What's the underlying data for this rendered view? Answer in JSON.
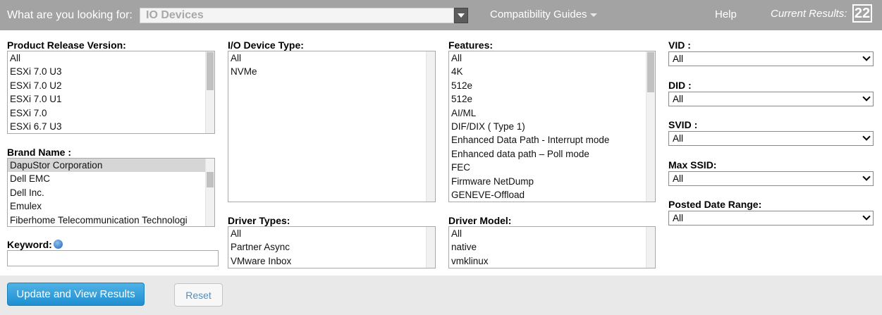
{
  "header": {
    "search_label": "What are you looking for:",
    "search_value": "IO Devices",
    "guides_label": "Compatibility Guides",
    "help_label": "Help",
    "results_label": "Current Results:",
    "results_count": "22"
  },
  "filters": {
    "product_release": {
      "label": "Product Release Version:",
      "options": [
        "All",
        "ESXi 7.0 U3",
        "ESXi 7.0 U2",
        "ESXi 7.0 U1",
        "ESXi 7.0",
        "ESXi 6.7 U3"
      ]
    },
    "brand": {
      "label": "Brand Name :",
      "options": [
        "DapuStor Corporation",
        "Dell EMC",
        "Dell Inc.",
        "Emulex",
        "Fiberhome Telecommunication Technologi"
      ]
    },
    "keyword": {
      "label": "Keyword:"
    },
    "io_device_type": {
      "label": "I/O Device Type:",
      "options": [
        "All",
        "NVMe"
      ]
    },
    "driver_types": {
      "label": "Driver Types:",
      "options": [
        "All",
        "Partner Async",
        "VMware Inbox"
      ]
    },
    "features": {
      "label": "Features:",
      "options": [
        "All",
        "4K",
        "512e",
        "512e",
        "AI/ML",
        "DIF/DIX ( Type 1)",
        "Enhanced Data Path - Interrupt mode",
        "Enhanced data path – Poll mode",
        "FEC",
        "Firmware NetDump",
        "GENEVE-Offload"
      ]
    },
    "driver_model": {
      "label": "Driver Model:",
      "options": [
        "All",
        "native",
        "vmklinux"
      ]
    },
    "vid": {
      "label": "VID :",
      "value": "All"
    },
    "did": {
      "label": "DID :",
      "value": "All"
    },
    "svid": {
      "label": "SVID :",
      "value": "All"
    },
    "max_ssid": {
      "label": "Max SSID:",
      "value": "All"
    },
    "posted_date": {
      "label": "Posted Date Range:",
      "value": "All"
    }
  },
  "actions": {
    "update_label": "Update and View Results",
    "reset_label": "Reset"
  },
  "icons": {
    "dropdown": "chevron-down-icon",
    "info": "info-icon"
  }
}
